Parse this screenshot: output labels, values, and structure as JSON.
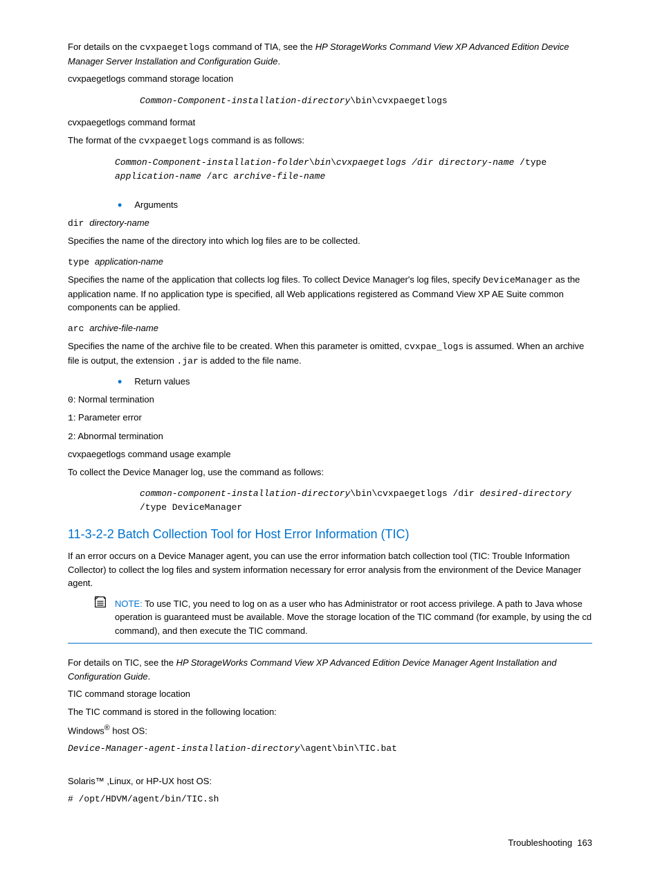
{
  "p_intro_1a": "For details on the ",
  "p_intro_1b": "cvxpaegetlogs",
  "p_intro_1c": " command of TIA, see the ",
  "p_intro_1d": "HP StorageWorks Command View XP Advanced Edition Device Manager Server Installation and Configuration Guide",
  "p_intro_1e": ".",
  "h_storage": "cvxpaegetlogs command storage location",
  "code_storage_a": "Common-Component-installation-directory",
  "code_storage_b": "\\bin\\cvxpaegetlogs",
  "h_format": "cvxpaegetlogs command format",
  "p_format_a": "The format of the ",
  "p_format_b": "cvxpaegetlogs",
  "p_format_c": " command is as follows:",
  "code_fmt_a": "Common-Component-installation-folder",
  "code_fmt_b": "\\",
  "code_fmt_c": "bin",
  "code_fmt_d": "\\",
  "code_fmt_e": "cvxpaegetlogs /dir directory-name ",
  "code_fmt_f": "/type",
  "code_fmt_g": "application-name ",
  "code_fmt_h": "/arc ",
  "code_fmt_i": "archive-file-name",
  "bullet_args": "Arguments",
  "arg1_a": "dir ",
  "arg1_b": "directory-name",
  "arg1_desc": "Specifies the name of the directory into which log files are to be collected.",
  "arg2_a": "type ",
  "arg2_b": "application-name",
  "arg2_desc_a": "Specifies the name of the application that collects log files. To collect Device Manager's log files, specify ",
  "arg2_desc_b": "DeviceManager",
  "arg2_desc_c": " as the application name. If no application type is specified, all Web applications registered as Command View XP AE Suite common components can be applied.",
  "arg3_a": "arc ",
  "arg3_b": "archive-file-name",
  "arg3_desc_a": "Specifies the name of the archive file to be created. When this parameter is omitted, ",
  "arg3_desc_b": "cvxpae_logs",
  "arg3_desc_c": " is assumed. When an archive file is output, the extension ",
  "arg3_desc_d": ".jar",
  "arg3_desc_e": " is added to the file name.",
  "bullet_return": "Return values",
  "ret1_a": "0",
  "ret1_b": ": Normal termination",
  "ret2_a": "1",
  "ret2_b": ": Parameter error",
  "ret3_a": "2",
  "ret3_b": ": Abnormal termination",
  "h_usage": "cvxpaegetlogs command usage example",
  "p_usage": "To collect the Device Manager log, use the command as follows:",
  "code_usage_a": "common-component-installation-directory",
  "code_usage_b": "\\bin\\cvxpaegetlogs /dir ",
  "code_usage_c": "desired-directory ",
  "code_usage_d": "/type DeviceManager",
  "section_heading": "11-3-2-2  Batch Collection Tool for Host Error Information (TIC)",
  "tic_intro": "If an error occurs on a Device Manager agent, you can use the error information batch collection tool (TIC: Trouble Information Collector) to collect the log files and system information necessary for error analysis from the environment of the Device Manager agent.",
  "note_label": "NOTE: ",
  "note_text": " To use TIC, you need to log on as a user who has Administrator or root access privilege. A path to Java whose operation is guaranteed must be available. Move the storage location of the TIC command (for example, by using the cd command), and then execute the TIC command.",
  "tic_details_a": "For details on TIC, see the ",
  "tic_details_b": "HP StorageWorks Command View XP Advanced Edition Device Manager Agent Installation and Configuration Guide",
  "tic_details_c": ".",
  "h_tic_storage": "TIC command storage location",
  "tic_storage_para": "The TIC command is stored in the following location:",
  "win_host_a": "Windows",
  "win_host_b": " host OS:",
  "code_win_a": "Device-Manager-agent-installation-directory",
  "code_win_b": "\\agent\\bin\\TIC.bat",
  "solaris_host": "Solaris™ ,Linux, or HP-UX host OS:",
  "code_solaris": "# /opt/HDVM/agent/bin/TIC.sh",
  "footer_a": "Troubleshooting",
  "footer_b": "163"
}
